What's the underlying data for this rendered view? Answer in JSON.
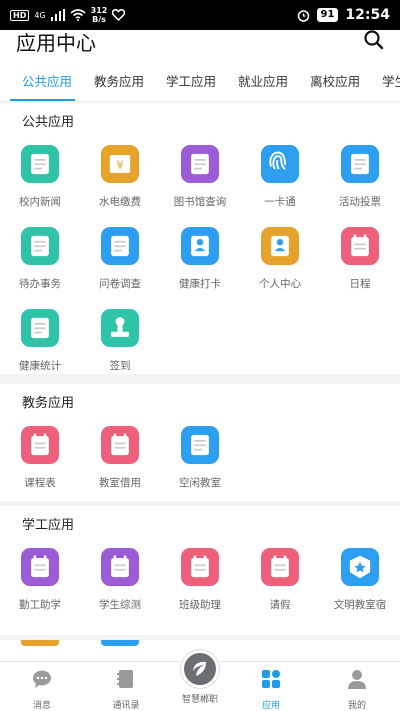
{
  "status_bar": {
    "network": "HD",
    "signal": "4G",
    "speed_value": "312",
    "speed_unit": "B/s",
    "battery": "91",
    "time": "12:54"
  },
  "header": {
    "title": "应用中心"
  },
  "tabs": [
    {
      "label": "公共应用",
      "active": true
    },
    {
      "label": "教务应用"
    },
    {
      "label": "学工应用"
    },
    {
      "label": "就业应用"
    },
    {
      "label": "离校应用"
    },
    {
      "label": "学生服务"
    }
  ],
  "sections": [
    {
      "title": "公共应用",
      "apps": [
        {
          "label": "校内新闻",
          "icon": "news-icon",
          "color": "#2fc4a8"
        },
        {
          "label": "水电缴费",
          "icon": "payment-icon",
          "color": "#e6a32b"
        },
        {
          "label": "图书馆查询",
          "icon": "library-icon",
          "color": "#9b5cd6"
        },
        {
          "label": "一卡通",
          "icon": "fingerprint-icon",
          "color": "#2d9ff0"
        },
        {
          "label": "活动投票",
          "icon": "vote-icon",
          "color": "#2d9ff0"
        },
        {
          "label": "待办事务",
          "icon": "todo-icon",
          "color": "#2fc4a8"
        },
        {
          "label": "问卷调查",
          "icon": "survey-icon",
          "color": "#2d9ff0"
        },
        {
          "label": "健康打卡",
          "icon": "health-checkin-icon",
          "color": "#2d9ff0"
        },
        {
          "label": "个人中心",
          "icon": "personal-center-icon",
          "color": "#e6a32b"
        },
        {
          "label": "日程",
          "icon": "calendar-icon",
          "color": "#ee5f7a"
        },
        {
          "label": "健康统计",
          "icon": "health-stats-icon",
          "color": "#2fc4a8"
        },
        {
          "label": "签到",
          "icon": "stamp-icon",
          "color": "#2fc4a8"
        }
      ]
    },
    {
      "title": "教务应用",
      "apps": [
        {
          "label": "课程表",
          "icon": "schedule-icon",
          "color": "#ee5f7a"
        },
        {
          "label": "教室借用",
          "icon": "classroom-borrow-icon",
          "color": "#ee5f7a"
        },
        {
          "label": "空闲教室",
          "icon": "free-classroom-icon",
          "color": "#2d9ff0"
        }
      ]
    },
    {
      "title": "学工应用",
      "apps": [
        {
          "label": "勤工助学",
          "icon": "work-study-icon",
          "color": "#9b5cd6"
        },
        {
          "label": "学生综测",
          "icon": "evaluation-icon",
          "color": "#9b5cd6"
        },
        {
          "label": "班级助理",
          "icon": "class-assistant-icon",
          "color": "#ee5f7a"
        },
        {
          "label": "请假",
          "icon": "leave-icon",
          "color": "#ee5f7a"
        },
        {
          "label": "文明教室宿",
          "icon": "badge-icon",
          "color": "#2d9ff0"
        }
      ]
    }
  ],
  "bottom_nav": [
    {
      "label": "消息",
      "icon": "message-icon"
    },
    {
      "label": "通讯录",
      "icon": "contacts-icon"
    },
    {
      "label": "智慧郴职",
      "icon": "home-logo-icon"
    },
    {
      "label": "应用",
      "icon": "apps-icon",
      "active": true
    },
    {
      "label": "我的",
      "icon": "profile-icon"
    }
  ],
  "colors": {
    "accent": "#1e9ce8"
  }
}
